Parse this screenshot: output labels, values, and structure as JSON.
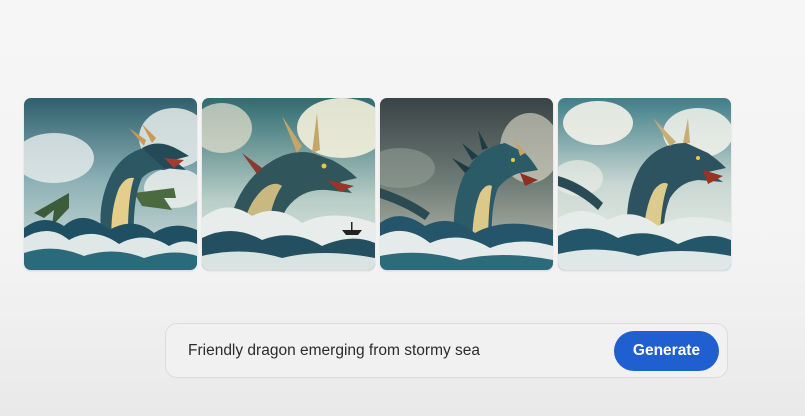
{
  "gallery": {
    "images": [
      {
        "icon": "dragon-sea-image-1"
      },
      {
        "icon": "dragon-sea-image-2"
      },
      {
        "icon": "dragon-sea-image-3"
      },
      {
        "icon": "dragon-sea-image-4"
      }
    ]
  },
  "prompt": {
    "text": "Friendly dragon emerging from stormy sea",
    "generate_label": "Generate"
  },
  "colors": {
    "accent": "#1f5fcf",
    "background": "#f4f4f4",
    "prompt_bar": "#f1f1f1"
  }
}
